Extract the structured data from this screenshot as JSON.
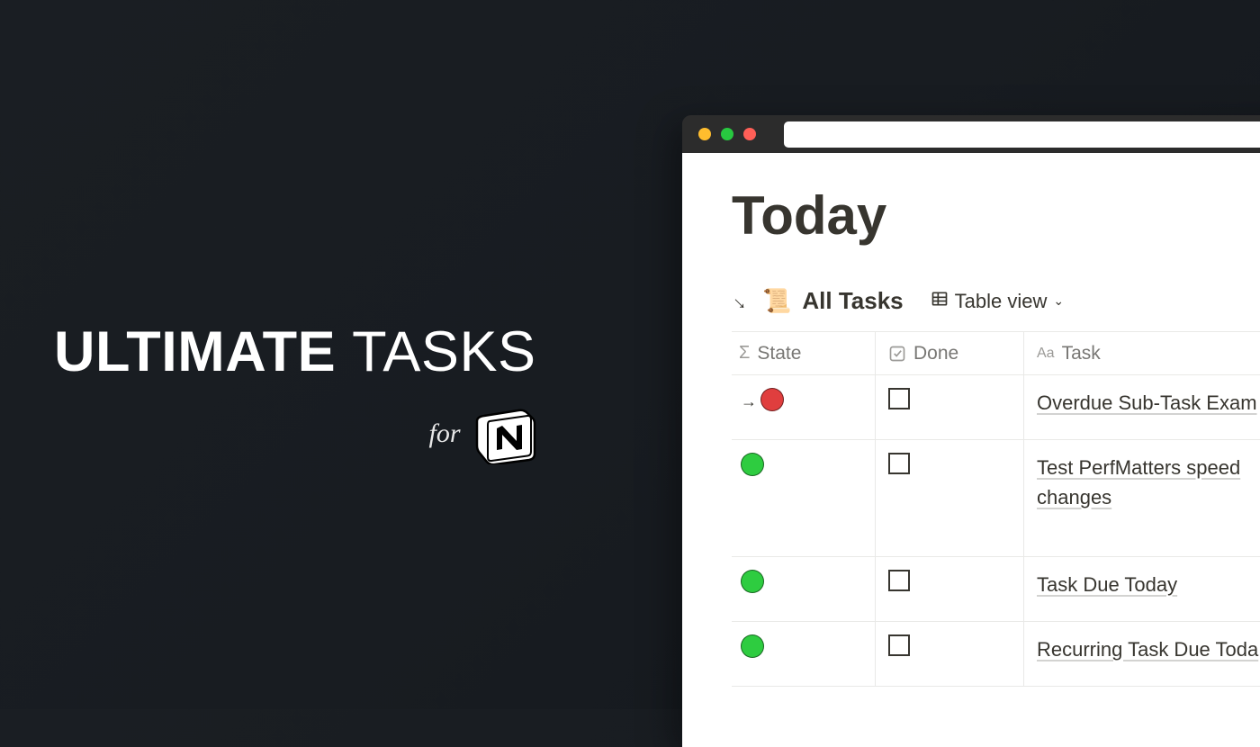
{
  "branding": {
    "title_bold": "ULTIMATE",
    "title_light": "TASKS",
    "for_label": "for",
    "logo_letter": "N"
  },
  "app": {
    "page_title": "Today",
    "view": {
      "source_name": "All Tasks",
      "view_type_label": "Table view"
    },
    "columns": {
      "state": "State",
      "done": "Done",
      "task": "Task"
    },
    "rows": [
      {
        "state_color": "red",
        "has_arrow": true,
        "done": false,
        "task": "Overdue Sub-Task Exam",
        "tall": false
      },
      {
        "state_color": "green",
        "has_arrow": false,
        "done": false,
        "task": "Test PerfMatters speed changes",
        "tall": true
      },
      {
        "state_color": "green",
        "has_arrow": false,
        "done": false,
        "task": "Task Due Today",
        "tall": false
      },
      {
        "state_color": "green",
        "has_arrow": false,
        "done": false,
        "task": "Recurring Task Due Toda",
        "tall": false
      }
    ]
  }
}
